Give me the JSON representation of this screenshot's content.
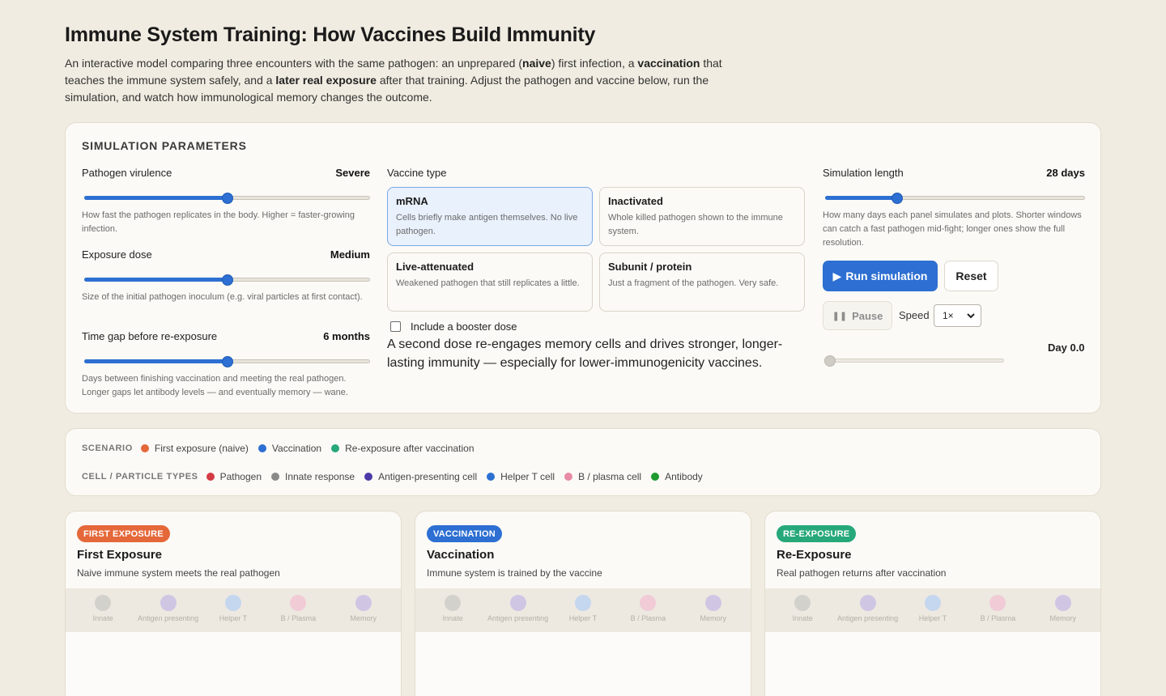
{
  "page": {
    "title": "Immune System Training: How Vaccines Build Immunity",
    "intro": {
      "p1": "An interactive model comparing three encounters with the same pathogen: an unprepared (",
      "b1": "naive",
      "p2": ") first infection, a ",
      "b2": "vaccination",
      "p3": " that teaches the immune system safely, and a ",
      "b3": "later real exposure",
      "p4": " after that training. Adjust the pathogen and vaccine below, run the simulation, and watch how immunological memory changes the outcome."
    }
  },
  "params": {
    "section_title": "SIMULATION PARAMETERS",
    "virulence": {
      "label": "Pathogen virulence",
      "value": "Severe",
      "level": 0.5,
      "desc": "How fast the pathogen replicates in the body. Higher = faster-growing infection."
    },
    "dose": {
      "label": "Exposure dose",
      "value": "Medium",
      "level": 0.5,
      "desc": "Size of the initial pathogen inoculum (e.g. viral particles at first contact)."
    },
    "gap": {
      "label": "Time gap before re-exposure",
      "value": "6 months",
      "level": 0.5,
      "desc": "Days between finishing vaccination and meeting the real pathogen. Longer gaps let antibody levels — and eventually memory — wane."
    },
    "vaccine": {
      "label": "Vaccine type",
      "options": [
        {
          "name": "mRNA",
          "desc": "Cells briefly make antigen themselves. No live pathogen.",
          "selected": true
        },
        {
          "name": "Inactivated",
          "desc": "Whole killed pathogen shown to the immune system.",
          "selected": false
        },
        {
          "name": "Live-attenuated",
          "desc": "Weakened pathogen that still replicates a little.",
          "selected": false
        },
        {
          "name": "Subunit / protein",
          "desc": "Just a fragment of the pathogen. Very safe.",
          "selected": false
        }
      ]
    },
    "booster": {
      "label": "Include a booster dose",
      "checked": false,
      "desc": "A second dose re-engages memory cells and drives stronger, longer-lasting immunity — especially for lower-immunogenicity vaccines."
    },
    "length": {
      "label": "Simulation length",
      "value": "28 days",
      "level": 0.27,
      "desc": "How many days each panel simulates and plots. Shorter windows can catch a fast pathogen mid-fight; longer ones show the full resolution."
    },
    "run_label": "Run simulation",
    "reset_label": "Reset",
    "pause_label": "Pause",
    "speed_label": "Speed",
    "speed_value": "1×",
    "day_label": "Day 0.0",
    "timeline_level": 0
  },
  "legend": {
    "scenario_key": "SCENARIO",
    "scenarios": [
      {
        "label": "First exposure (naive)",
        "color": "#e5683a"
      },
      {
        "label": "Vaccination",
        "color": "#2d6fd2"
      },
      {
        "label": "Re-exposure after vaccination",
        "color": "#26a87b"
      }
    ],
    "cell_key": "CELL / PARTICLE TYPES",
    "cells": [
      {
        "label": "Pathogen",
        "color": "#d43b45"
      },
      {
        "label": "Innate response",
        "color": "#8a8a8a"
      },
      {
        "label": "Antigen-presenting cell",
        "color": "#4b3aa6"
      },
      {
        "label": "Helper T cell",
        "color": "#2d6fd2"
      },
      {
        "label": "B / plasma cell",
        "color": "#e88aa6"
      },
      {
        "label": "Antibody",
        "color": "#1e9a2e"
      }
    ]
  },
  "panels": [
    {
      "badge": "FIRST EXPOSURE",
      "badge_color": "#e5683a",
      "title": "First Exposure",
      "subtitle": "Naive immune system meets the real pathogen"
    },
    {
      "badge": "VACCINATION",
      "badge_color": "#2d6fd2",
      "title": "Vaccination",
      "subtitle": "Immune system is trained by the vaccine"
    },
    {
      "badge": "RE-EXPOSURE",
      "badge_color": "#26a87b",
      "title": "Re-Exposure",
      "subtitle": "Real pathogen returns after vaccination"
    }
  ],
  "cell_strip": [
    {
      "label": "Innate",
      "color": "#d3d1cc"
    },
    {
      "label": "Antigen presenting",
      "color": "#cfc6e4"
    },
    {
      "label": "Helper T",
      "color": "#c5d6ef"
    },
    {
      "label": "B / Plasma",
      "color": "#f1cbd6"
    },
    {
      "label": "Memory",
      "color": "#d0c6e4"
    }
  ]
}
